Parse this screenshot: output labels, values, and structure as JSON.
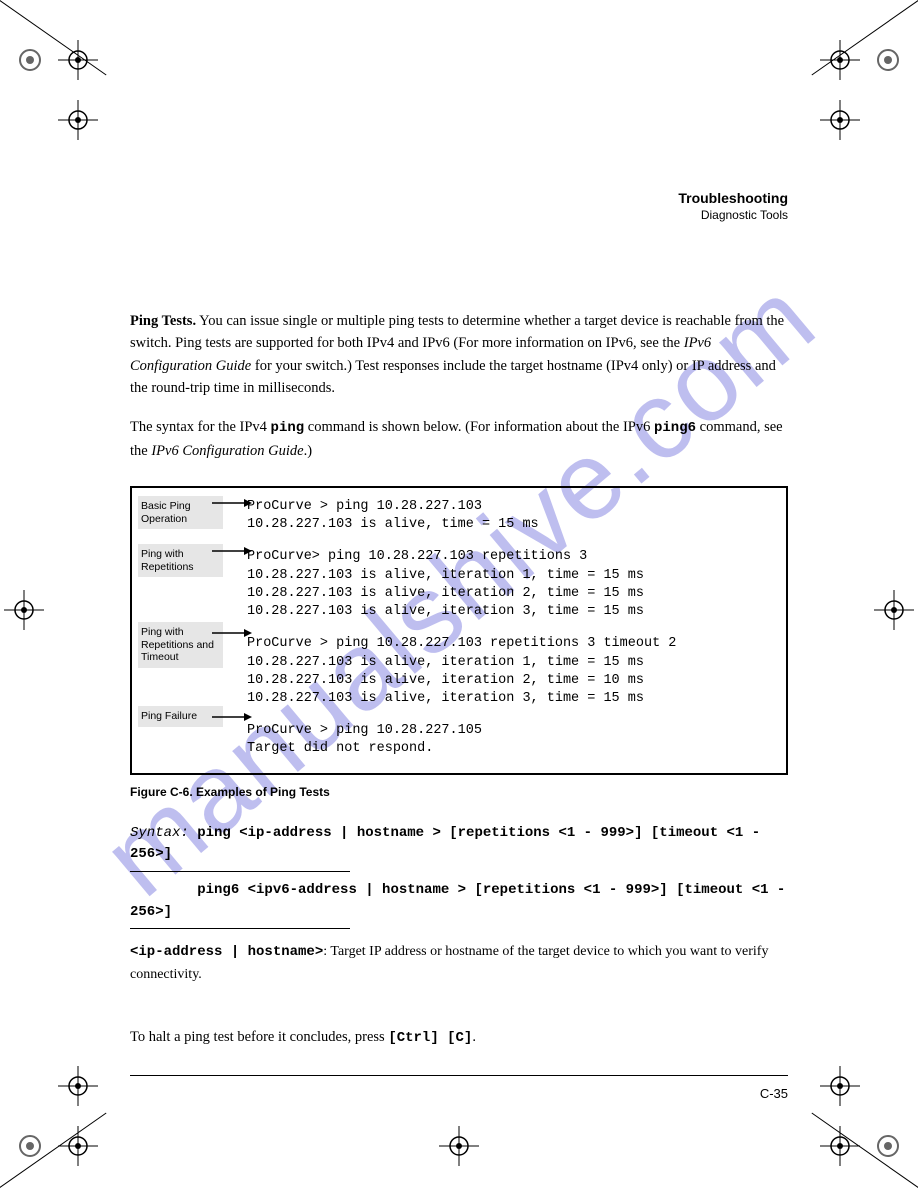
{
  "watermark": "manualshive.com",
  "header": {
    "title": "Troubleshooting",
    "subtitle": "Diagnostic Tools"
  },
  "body": {
    "p1_a": "Ping Tests.",
    "p1_b": " You can issue single or multiple ping tests to determine whether a target device is reachable from the switch. Ping tests are supported for both IPv4 and IPv6 (For more information on IPv6, see the ",
    "p1_c": "IPv6 Configuration Guide",
    "p1_d": " for your switch.) Test responses include the target hostname (IPv4 only) or IP address and the round-trip time in milliseconds.",
    "p2_a": "The syntax for the IPv4 ",
    "p2_b": "ping",
    "p2_c": " command is shown below. (For information about the IPv6 ",
    "p2_d": "ping6",
    "p2_e": " command, see the ",
    "p2_f": "IPv6 Configuration Guide",
    "p2_g": ".)"
  },
  "figure": {
    "labels": {
      "l1": "Basic Ping Operation",
      "l2": "Ping with Repetitions",
      "l3": "Ping with Repetitions and Timeout",
      "l4": "Ping Failure"
    },
    "block1": "ProCurve > ping 10.28.227.103\n10.28.227.103 is alive, time = 15 ms",
    "block2": "ProCurve> ping 10.28.227.103 repetitions 3\n10.28.227.103 is alive, iteration 1, time = 15 ms\n10.28.227.103 is alive, iteration 2, time = 15 ms\n10.28.227.103 is alive, iteration 3, time = 15 ms",
    "block3": "ProCurve > ping 10.28.227.103 repetitions 3 timeout 2\n10.28.227.103 is alive, iteration 1, time = 15 ms\n10.28.227.103 is alive, iteration 2, time = 10 ms\n10.28.227.103 is alive, iteration 3, time = 15 ms",
    "block4": "ProCurve > ping 10.28.227.105\nTarget did not respond.",
    "caption": "Figure C-6. Examples of Ping Tests"
  },
  "syntax": {
    "s_label": "Syntax:",
    "s1": " ping <ip-address | hostname > [repetitions <1 - 999>] [timeout <1 - 256>]",
    "s2": " ping6 <ipv6-address | hostname > [repetitions <1 - 999>] [timeout <1 - 256>]",
    "opt_a": "<ip-address | hostname>",
    "opt_b": ": Target IP address or hostname of the target device to which you want to verify connectivity."
  },
  "footer": {
    "note_a": "To halt a ping test before it concludes, press ",
    "note_b": "[Ctrl] [C]",
    "note_c": "."
  },
  "page_number": "C-35"
}
